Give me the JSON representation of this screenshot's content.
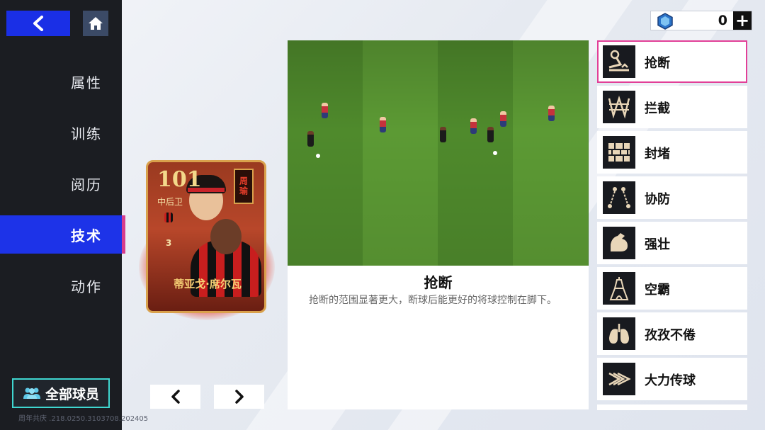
{
  "nav": {
    "back_icon": "chevron-left-icon",
    "home_icon": "home-icon",
    "items": [
      {
        "label": "属性",
        "active": false
      },
      {
        "label": "训练",
        "active": false
      },
      {
        "label": "阅历",
        "active": false
      },
      {
        "label": "技术",
        "active": true
      },
      {
        "label": "动作",
        "active": false
      }
    ],
    "all_players_label": "全部球员",
    "footer": "周年共庆 .218.0250.3103708.202405"
  },
  "currency": {
    "value": "0",
    "plus_label": "+"
  },
  "card": {
    "rating": "101",
    "position": "中后卫",
    "number": "3",
    "stamp": "周瑜",
    "name": "蒂亚戈·席尔瓦"
  },
  "pager": {
    "prev": "‹",
    "next": "›"
  },
  "skill_detail": {
    "title": "抢断",
    "description": "抢断的范围显著更大，断球后能更好的将球控制在脚下。"
  },
  "skills": [
    {
      "label": "抢断",
      "icon": "tackle-icon",
      "selected": true
    },
    {
      "label": "拦截",
      "icon": "intercept-icon",
      "selected": false
    },
    {
      "label": "封堵",
      "icon": "block-wall-icon",
      "selected": false
    },
    {
      "label": "协防",
      "icon": "cover-defense-icon",
      "selected": false
    },
    {
      "label": "强壮",
      "icon": "muscle-arm-icon",
      "selected": false
    },
    {
      "label": "空霸",
      "icon": "tower-icon",
      "selected": false
    },
    {
      "label": "孜孜不倦",
      "icon": "lungs-icon",
      "selected": false
    },
    {
      "label": "大力传球",
      "icon": "power-pass-icon",
      "selected": false
    }
  ],
  "colors": {
    "accent_blue": "#1d33e8",
    "highlight_pink": "#e23f97",
    "sidebar_bg": "#1b1d22"
  }
}
